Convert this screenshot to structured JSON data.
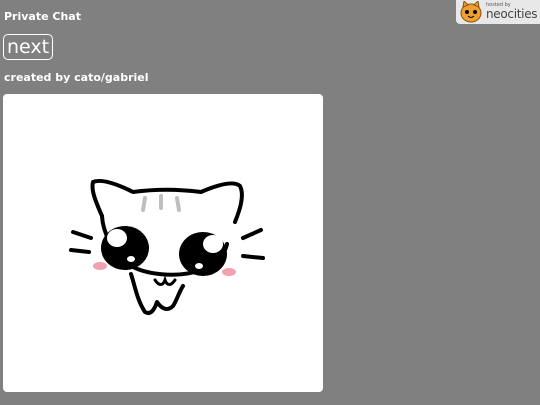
{
  "page": {
    "title": "Private Chat",
    "credit": "created by cato/gabriel"
  },
  "controls": {
    "next_label": "next"
  },
  "drawing": {
    "subject": "kitten-doodle",
    "background_color": "#ffffff",
    "line_color": "#000000",
    "stripe_color": "#bfbfbf",
    "blush_color": "#f2a0b0"
  },
  "badge": {
    "small_text": "hosted by",
    "name": "neocities",
    "mascot": "neocities-cat-icon"
  },
  "colors": {
    "page_background": "#808080",
    "text": "#ffffff"
  }
}
